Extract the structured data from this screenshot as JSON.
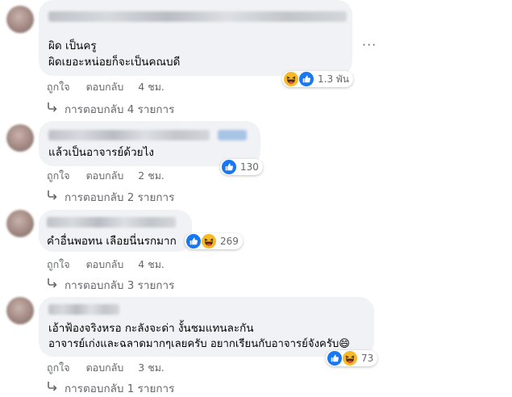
{
  "comments": [
    {
      "lines": [
        "ผิด เป็นครู",
        "ผิดเยอะหน่อยก็จะเป็นคณบดี"
      ],
      "like": "ถูกใจ",
      "reply": "ตอบกลับ",
      "time": "4 ชม.",
      "reaction_count": "1.3 พัน",
      "replies": "การตอบกลับ 4 รายการ",
      "reaction_icons": [
        "haha-icon",
        "like-icon"
      ]
    },
    {
      "lines": [
        "แล้วเป็นอาจารย์ด้วยไง"
      ],
      "like": "ถูกใจ",
      "reply": "ตอบกลับ",
      "time": "2 ชม.",
      "reaction_count": "130",
      "replies": "การตอบกลับ 2 รายการ",
      "reaction_icons": [
        "like-icon"
      ]
    },
    {
      "lines": [
        "คำอื่นพอทน เลือยนี่นรกมาก"
      ],
      "like": "ถูกใจ",
      "reply": "ตอบกลับ",
      "time": "4 ชม.",
      "reaction_count": "269",
      "replies": "การตอบกลับ 3 รายการ",
      "reaction_icons": [
        "like-icon",
        "haha-icon"
      ]
    },
    {
      "lines": [
        "เอ้าฟ้องจริงหรอ กะลังจะด่า งั้นชมแทนละกัน",
        "อาจารย์เก่งและฉลาดมากๆเลยครับ อยากเรียนกับอาจารย์จังครับ😄"
      ],
      "like": "ถูกใจ",
      "reply": "ตอบกลับ",
      "time": "3 ชม.",
      "reaction_count": "73",
      "replies": "การตอบกลับ 1 รายการ",
      "reaction_icons": [
        "like-icon",
        "haha-icon"
      ]
    }
  ],
  "more_menu": "···",
  "colors": {
    "like": "#1877f2",
    "haha": "#f7b928",
    "bubble": "#f0f2f5",
    "muted": "#65676b"
  }
}
